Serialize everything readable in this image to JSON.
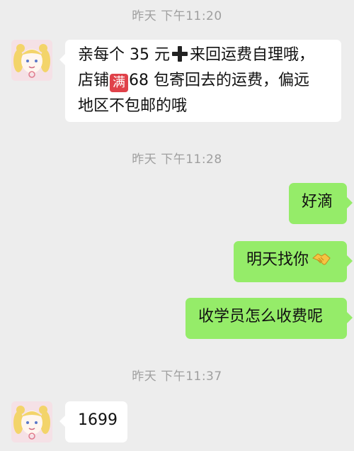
{
  "timestamps": [
    "昨天 下午11:20",
    "昨天 下午11:28",
    "昨天 下午11:37"
  ],
  "messages": [
    {
      "side": "left",
      "line1_a": "亲每个 35 元",
      "plus_icon": "heavy-plus-sign",
      "line1_b": "来回运费自理哦，",
      "line2_a": "店铺",
      "badge": "满",
      "line2_b": "68 包寄回去的运费，偏远",
      "line3": "地区不包邮的哦"
    },
    {
      "side": "right",
      "text": "好滴"
    },
    {
      "side": "right",
      "text": "明天找你",
      "icon": "handshake-icon"
    },
    {
      "side": "right",
      "text": "收学员怎么收费呢"
    },
    {
      "side": "left",
      "text": "1699"
    }
  ],
  "colors": {
    "background": "#ededed",
    "bubble_in": "#ffffff",
    "bubble_out": "#95ec69",
    "timestamp": "#9f9f9f",
    "badge": "#e0424a"
  }
}
